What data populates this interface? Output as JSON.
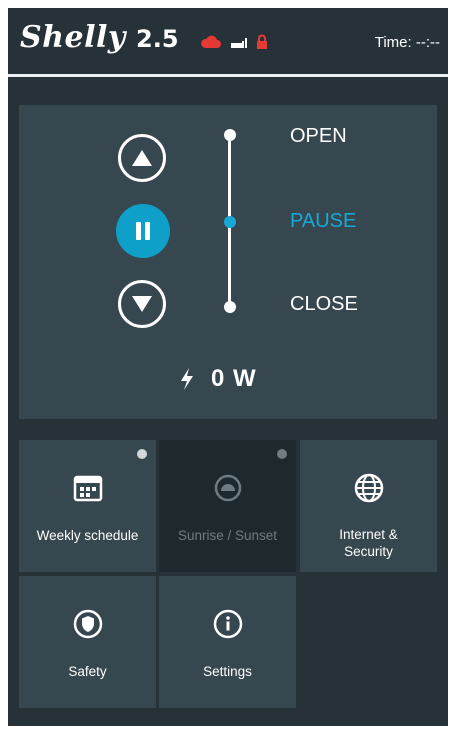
{
  "header": {
    "logo_text": "Shelly",
    "model": "2.5",
    "time_label": "Time:",
    "time_value": "--:--",
    "status_icons": [
      "cloud-icon",
      "wifi-plug-icon",
      "lock-icon"
    ],
    "accent_red": "#e53935"
  },
  "control": {
    "open_label": "OPEN",
    "pause_label": "PAUSE",
    "close_label": "CLOSE",
    "active_state": "PAUSE",
    "power_value": "0 W",
    "accent_color": "#17a9d6"
  },
  "tiles": [
    {
      "label": "Weekly schedule",
      "icon": "calendar-icon",
      "disabled": false,
      "badge": true
    },
    {
      "label": "Sunrise / Sunset",
      "icon": "sun-icon",
      "disabled": true,
      "badge": true
    },
    {
      "label": "Internet &\nSecurity",
      "icon": "globe-icon",
      "disabled": false,
      "badge": false
    },
    {
      "label": "Safety",
      "icon": "shield-icon",
      "disabled": false,
      "badge": false
    },
    {
      "label": "Settings",
      "icon": "info-icon",
      "disabled": false,
      "badge": false
    }
  ]
}
